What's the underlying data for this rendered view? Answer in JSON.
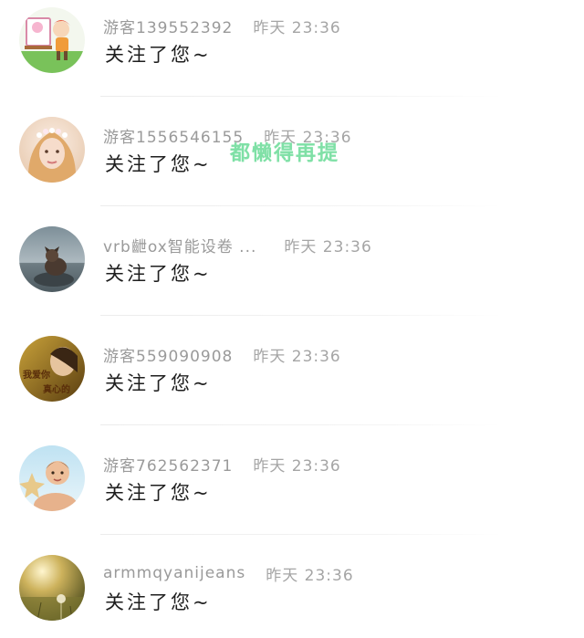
{
  "notifications": [
    {
      "username": "游客139552392",
      "time": "昨天 23:36",
      "message": "关注了您~",
      "avatar": "cartoon-girl-painting"
    },
    {
      "username": "游客1556546155",
      "time": "昨天 23:36",
      "message": "关注了您~",
      "avatar": "blonde-girl-flower-crown"
    },
    {
      "username": "vrb齛ox智能设卷 ...",
      "time": "昨天 23:36",
      "message": "关注了您~",
      "avatar": "dog-on-rock"
    },
    {
      "username": "游客559090908",
      "time": "昨天 23:36",
      "message": "关注了您~",
      "avatar": "woman-with-text-overlay"
    },
    {
      "username": "游客762562371",
      "time": "昨天 23:36",
      "message": "关注了您~",
      "avatar": "boy-with-starfish"
    },
    {
      "username": "armmqyanijeans",
      "time": "昨天 23:36",
      "message": "关注了您~",
      "avatar": "sunset-dandelion"
    }
  ],
  "overlay_text": "都懒得再提",
  "avatar_texts": {
    "line1": "我爱你",
    "line2": "真心的"
  },
  "colors": {
    "username": "#9a9a9a",
    "message": "#1e1e1e",
    "overlay": "#7fe0a6",
    "separator": "#ececec"
  }
}
